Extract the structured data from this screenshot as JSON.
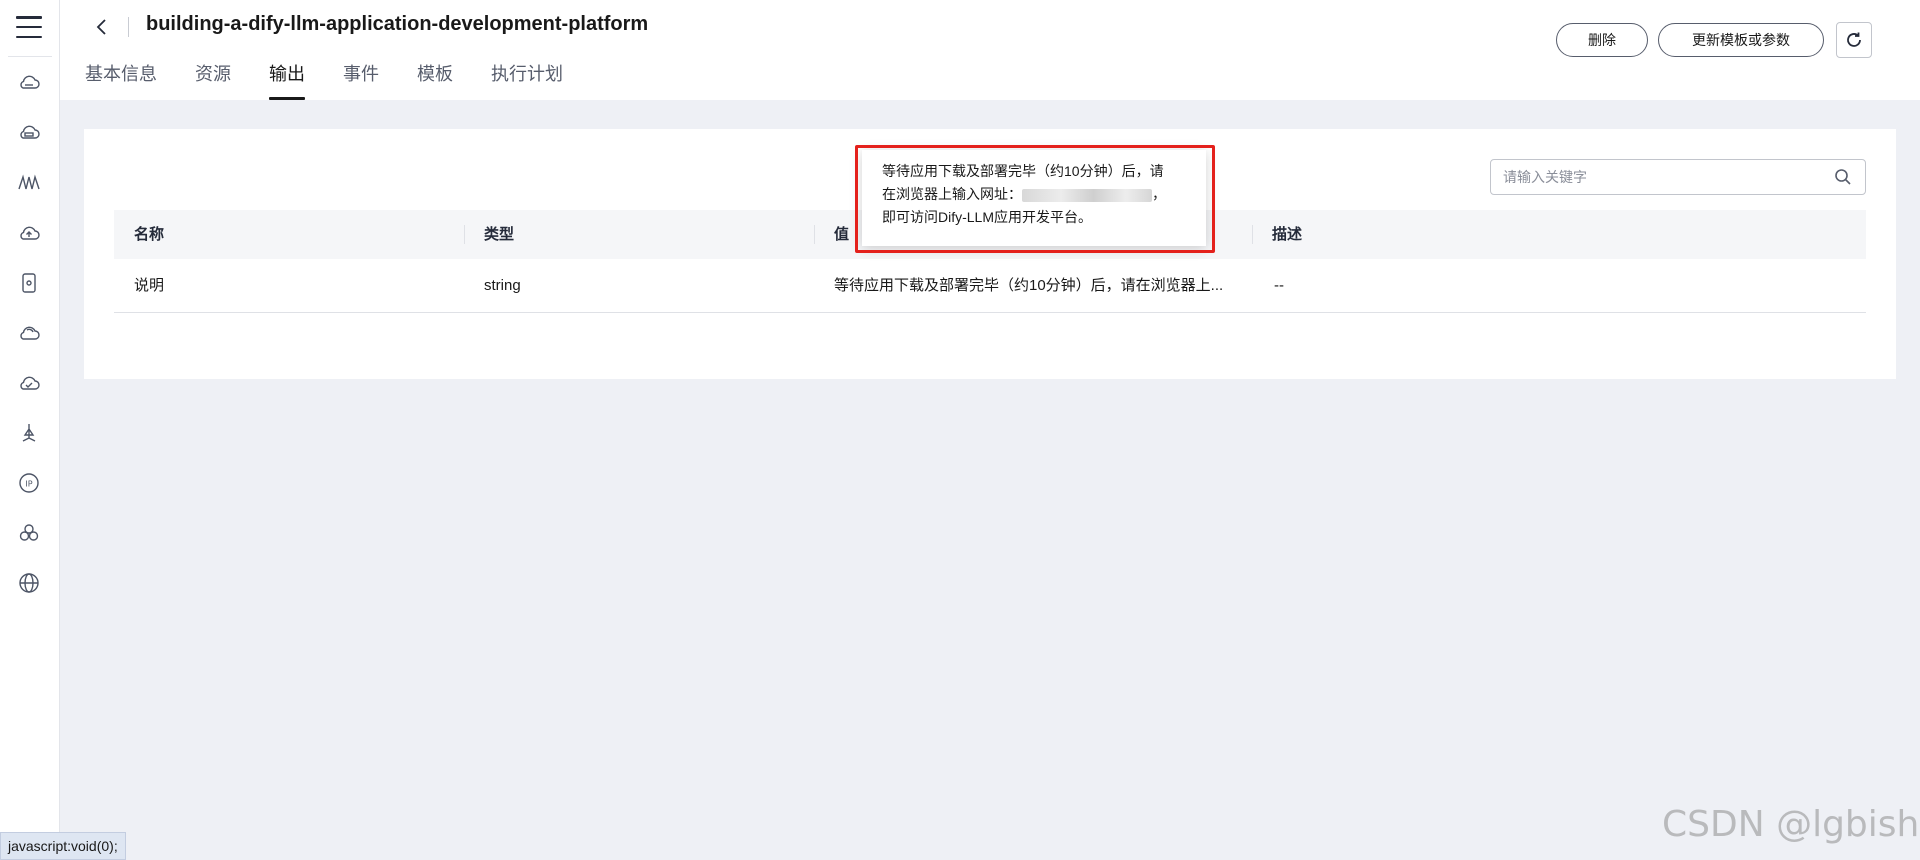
{
  "header": {
    "title": "building-a-dify-llm-application-development-platform",
    "tabs": [
      {
        "label": "基本信息"
      },
      {
        "label": "资源"
      },
      {
        "label": "输出",
        "active": true
      },
      {
        "label": "事件"
      },
      {
        "label": "模板"
      },
      {
        "label": "执行计划"
      }
    ],
    "actions": {
      "delete_label": "删除",
      "update_label": "更新模板或参数"
    }
  },
  "sidebar": {
    "icons": [
      "cloud-server-icon",
      "cloud-disk-icon",
      "waveform-icon",
      "cloud-upload-icon",
      "device-icon",
      "cloud-icon",
      "cloud-check-icon",
      "network-tree-icon",
      "ip-icon",
      "cluster-icon",
      "globe-icon"
    ]
  },
  "search": {
    "placeholder": "请输入关键字"
  },
  "table": {
    "headers": {
      "name": "名称",
      "type": "类型",
      "value": "值",
      "desc": "描述"
    },
    "rows": [
      {
        "name": "说明",
        "type": "string",
        "value": "等待应用下载及部署完毕（约10分钟）后，请在浏览器上...",
        "desc": "--"
      }
    ]
  },
  "tooltip": {
    "line1": "等待应用下载及部署完毕（约10分钟）后，请",
    "line2_prefix": "在浏览器上输入网址：",
    "line2_suffix": "，",
    "line3": "即可访问Dify-LLM应用开发平台。"
  },
  "status_bar": {
    "text": "javascript:void(0);"
  },
  "watermark": {
    "text": "CSDN @lgbisha"
  },
  "colors": {
    "highlight": "#e4211c",
    "active_tab": "#191919",
    "page_bg": "#eef0f5"
  }
}
